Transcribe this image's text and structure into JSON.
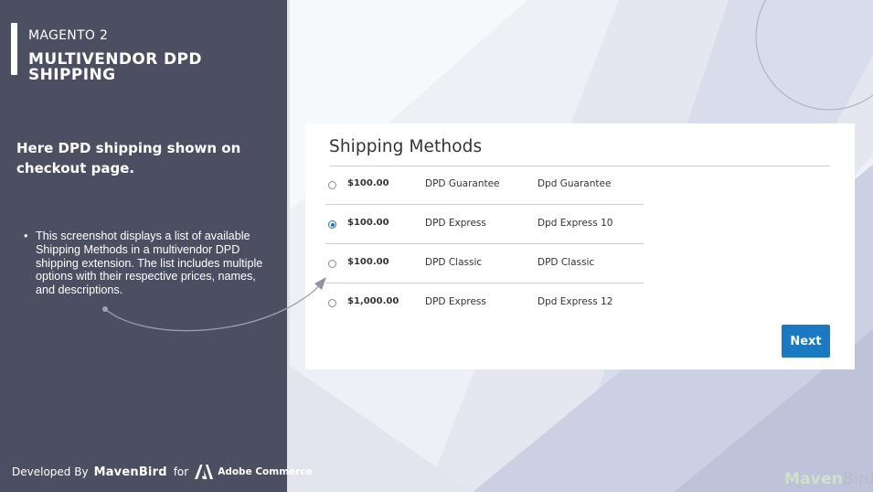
{
  "sidebar": {
    "eyebrow": "MAGENTO 2",
    "title": "MULTIVENDOR DPD SHIPPING",
    "headline": "Here DPD shipping  shown on checkout page.",
    "bullets": [
      "This screenshot displays a list of available Shipping Methods in a multivendor DPD shipping extension. The list includes multiple options with their respective prices, names, and descriptions."
    ],
    "footer": {
      "developed_by": "Developed By",
      "brand": "MavenBird",
      "for": "for",
      "adobe": "Adobe Commerce"
    }
  },
  "checkout": {
    "title": "Shipping Methods",
    "methods": [
      {
        "price": "$100.00",
        "carrier": "DPD Guarantee",
        "method": "Dpd Guarantee",
        "selected": false
      },
      {
        "price": "$100.00",
        "carrier": "DPD Express",
        "method": "Dpd Express 10",
        "selected": true
      },
      {
        "price": "$100.00",
        "carrier": "DPD Classic",
        "method": "DPD Classic",
        "selected": false
      },
      {
        "price": "$1,000.00",
        "carrier": "DPD Express",
        "method": "Dpd Express 12",
        "selected": false
      }
    ],
    "next_label": "Next"
  },
  "watermark": {
    "part1": "Maven",
    "part2": "Bird"
  },
  "colors": {
    "sidebar_bg": "#4c4e61",
    "accent_blue": "#1979c3",
    "page_bg": "#eceef5"
  },
  "icons": {
    "adobe_logo": "adobe-logo-icon",
    "radio_selected": "radio-selected-icon",
    "radio_unselected": "radio-unselected-icon"
  }
}
